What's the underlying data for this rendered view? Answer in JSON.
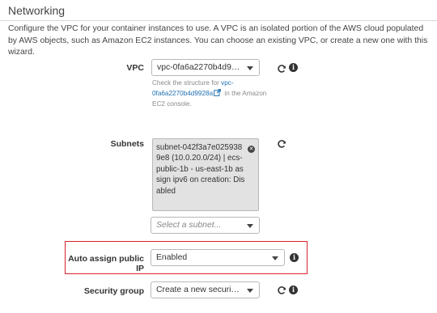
{
  "section": {
    "title": "Networking",
    "description": "Configure the VPC for your container instances to use. A VPC is an isolated portion of the AWS cloud populated by AWS objects, such as Amazon EC2 instances. You can choose an existing VPC, or create a new one with this wizard."
  },
  "vpc": {
    "label": "VPC",
    "value": "vpc-0fa6a2270b4d9928a",
    "help_prefix": "Check the structure for",
    "help_link": "vpc-0fa6a2270b4d9928a",
    "help_suffix": "in the Amazon EC2 console."
  },
  "subnets": {
    "label": "Subnets",
    "selected_token": "subnet-042f3a7e0259389e8 (10.0.20.0/24) | ecs-public-1b - us-east-1b assign ipv6 on creation: Disabled",
    "placeholder": "Select a subnet..."
  },
  "auto_assign_ip": {
    "label": "Auto assign public IP",
    "value": "Enabled"
  },
  "security_group": {
    "label": "Security group",
    "value": "Create a new security group"
  },
  "icons": {
    "refresh": "refresh-icon",
    "info": "info-icon",
    "external": "external-link-icon",
    "remove": "remove-token-icon"
  },
  "colors": {
    "link": "#1f6fb2",
    "highlight_border": "#d9232a"
  }
}
